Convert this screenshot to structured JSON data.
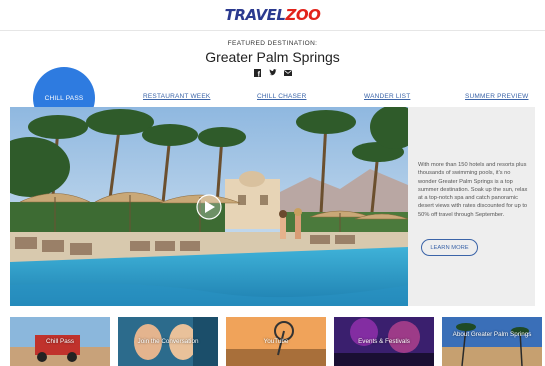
{
  "header": {
    "logo_part1": "TRAVEL",
    "logo_part2": "ZOO",
    "kicker": "FEATURED DESTINATION:",
    "title": "Greater Palm Springs",
    "social": [
      "facebook-icon",
      "twitter-icon",
      "email-icon"
    ]
  },
  "nav": {
    "items": [
      "CHILL PASS",
      "RESTAURANT WEEK",
      "CHILL CHASER",
      "WANDER LIST",
      "SUMMER PREVIEW"
    ],
    "active_index": 0
  },
  "hero": {
    "description": "With more than 150 hotels and resorts plus thousands of swimming pools, it's no wonder Greater Palm Springs is a top summer destination. Soak up the sun, relax at a top-notch spa and catch panoramic desert views with rates discounted for up to 50% off travel through September.",
    "cta": "LEARN MORE"
  },
  "tiles": [
    {
      "label": "Chill Pass"
    },
    {
      "label": "Join the Conversation"
    },
    {
      "label": "YouTube"
    },
    {
      "label": "Events & Festivals"
    },
    {
      "label": "About Greater Palm Springs"
    }
  ],
  "colors": {
    "logo_blue": "#2b3a8f",
    "logo_red": "#e2231a",
    "accent_blue": "#2e7be0",
    "link_blue": "#3b64a8",
    "panel_gray": "#eeeeee"
  }
}
